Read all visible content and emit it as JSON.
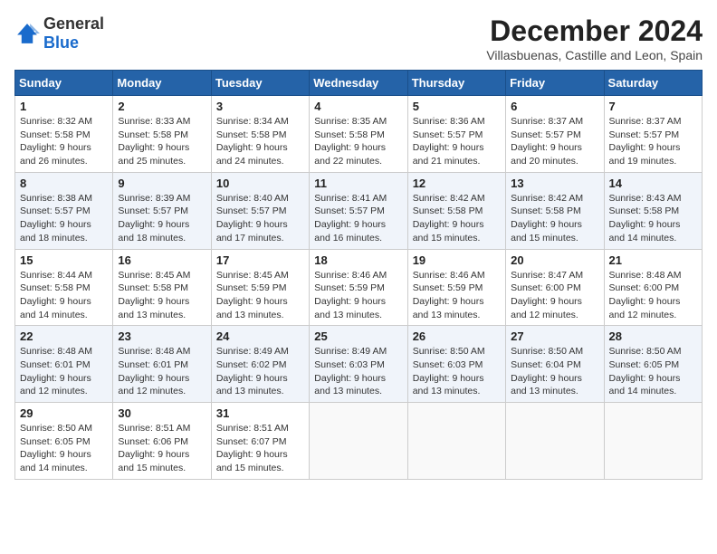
{
  "logo": {
    "text_general": "General",
    "text_blue": "Blue"
  },
  "header": {
    "month_title": "December 2024",
    "location": "Villasbuenas, Castille and Leon, Spain"
  },
  "weekdays": [
    "Sunday",
    "Monday",
    "Tuesday",
    "Wednesday",
    "Thursday",
    "Friday",
    "Saturday"
  ],
  "weeks": [
    [
      {
        "day": "1",
        "sunrise": "Sunrise: 8:32 AM",
        "sunset": "Sunset: 5:58 PM",
        "daylight": "Daylight: 9 hours and 26 minutes."
      },
      {
        "day": "2",
        "sunrise": "Sunrise: 8:33 AM",
        "sunset": "Sunset: 5:58 PM",
        "daylight": "Daylight: 9 hours and 25 minutes."
      },
      {
        "day": "3",
        "sunrise": "Sunrise: 8:34 AM",
        "sunset": "Sunset: 5:58 PM",
        "daylight": "Daylight: 9 hours and 24 minutes."
      },
      {
        "day": "4",
        "sunrise": "Sunrise: 8:35 AM",
        "sunset": "Sunset: 5:58 PM",
        "daylight": "Daylight: 9 hours and 22 minutes."
      },
      {
        "day": "5",
        "sunrise": "Sunrise: 8:36 AM",
        "sunset": "Sunset: 5:57 PM",
        "daylight": "Daylight: 9 hours and 21 minutes."
      },
      {
        "day": "6",
        "sunrise": "Sunrise: 8:37 AM",
        "sunset": "Sunset: 5:57 PM",
        "daylight": "Daylight: 9 hours and 20 minutes."
      },
      {
        "day": "7",
        "sunrise": "Sunrise: 8:37 AM",
        "sunset": "Sunset: 5:57 PM",
        "daylight": "Daylight: 9 hours and 19 minutes."
      }
    ],
    [
      {
        "day": "8",
        "sunrise": "Sunrise: 8:38 AM",
        "sunset": "Sunset: 5:57 PM",
        "daylight": "Daylight: 9 hours and 18 minutes."
      },
      {
        "day": "9",
        "sunrise": "Sunrise: 8:39 AM",
        "sunset": "Sunset: 5:57 PM",
        "daylight": "Daylight: 9 hours and 18 minutes."
      },
      {
        "day": "10",
        "sunrise": "Sunrise: 8:40 AM",
        "sunset": "Sunset: 5:57 PM",
        "daylight": "Daylight: 9 hours and 17 minutes."
      },
      {
        "day": "11",
        "sunrise": "Sunrise: 8:41 AM",
        "sunset": "Sunset: 5:57 PM",
        "daylight": "Daylight: 9 hours and 16 minutes."
      },
      {
        "day": "12",
        "sunrise": "Sunrise: 8:42 AM",
        "sunset": "Sunset: 5:58 PM",
        "daylight": "Daylight: 9 hours and 15 minutes."
      },
      {
        "day": "13",
        "sunrise": "Sunrise: 8:42 AM",
        "sunset": "Sunset: 5:58 PM",
        "daylight": "Daylight: 9 hours and 15 minutes."
      },
      {
        "day": "14",
        "sunrise": "Sunrise: 8:43 AM",
        "sunset": "Sunset: 5:58 PM",
        "daylight": "Daylight: 9 hours and 14 minutes."
      }
    ],
    [
      {
        "day": "15",
        "sunrise": "Sunrise: 8:44 AM",
        "sunset": "Sunset: 5:58 PM",
        "daylight": "Daylight: 9 hours and 14 minutes."
      },
      {
        "day": "16",
        "sunrise": "Sunrise: 8:45 AM",
        "sunset": "Sunset: 5:58 PM",
        "daylight": "Daylight: 9 hours and 13 minutes."
      },
      {
        "day": "17",
        "sunrise": "Sunrise: 8:45 AM",
        "sunset": "Sunset: 5:59 PM",
        "daylight": "Daylight: 9 hours and 13 minutes."
      },
      {
        "day": "18",
        "sunrise": "Sunrise: 8:46 AM",
        "sunset": "Sunset: 5:59 PM",
        "daylight": "Daylight: 9 hours and 13 minutes."
      },
      {
        "day": "19",
        "sunrise": "Sunrise: 8:46 AM",
        "sunset": "Sunset: 5:59 PM",
        "daylight": "Daylight: 9 hours and 13 minutes."
      },
      {
        "day": "20",
        "sunrise": "Sunrise: 8:47 AM",
        "sunset": "Sunset: 6:00 PM",
        "daylight": "Daylight: 9 hours and 12 minutes."
      },
      {
        "day": "21",
        "sunrise": "Sunrise: 8:48 AM",
        "sunset": "Sunset: 6:00 PM",
        "daylight": "Daylight: 9 hours and 12 minutes."
      }
    ],
    [
      {
        "day": "22",
        "sunrise": "Sunrise: 8:48 AM",
        "sunset": "Sunset: 6:01 PM",
        "daylight": "Daylight: 9 hours and 12 minutes."
      },
      {
        "day": "23",
        "sunrise": "Sunrise: 8:48 AM",
        "sunset": "Sunset: 6:01 PM",
        "daylight": "Daylight: 9 hours and 12 minutes."
      },
      {
        "day": "24",
        "sunrise": "Sunrise: 8:49 AM",
        "sunset": "Sunset: 6:02 PM",
        "daylight": "Daylight: 9 hours and 13 minutes."
      },
      {
        "day": "25",
        "sunrise": "Sunrise: 8:49 AM",
        "sunset": "Sunset: 6:03 PM",
        "daylight": "Daylight: 9 hours and 13 minutes."
      },
      {
        "day": "26",
        "sunrise": "Sunrise: 8:50 AM",
        "sunset": "Sunset: 6:03 PM",
        "daylight": "Daylight: 9 hours and 13 minutes."
      },
      {
        "day": "27",
        "sunrise": "Sunrise: 8:50 AM",
        "sunset": "Sunset: 6:04 PM",
        "daylight": "Daylight: 9 hours and 13 minutes."
      },
      {
        "day": "28",
        "sunrise": "Sunrise: 8:50 AM",
        "sunset": "Sunset: 6:05 PM",
        "daylight": "Daylight: 9 hours and 14 minutes."
      }
    ],
    [
      {
        "day": "29",
        "sunrise": "Sunrise: 8:50 AM",
        "sunset": "Sunset: 6:05 PM",
        "daylight": "Daylight: 9 hours and 14 minutes."
      },
      {
        "day": "30",
        "sunrise": "Sunrise: 8:51 AM",
        "sunset": "Sunset: 6:06 PM",
        "daylight": "Daylight: 9 hours and 15 minutes."
      },
      {
        "day": "31",
        "sunrise": "Sunrise: 8:51 AM",
        "sunset": "Sunset: 6:07 PM",
        "daylight": "Daylight: 9 hours and 15 minutes."
      },
      null,
      null,
      null,
      null
    ]
  ]
}
